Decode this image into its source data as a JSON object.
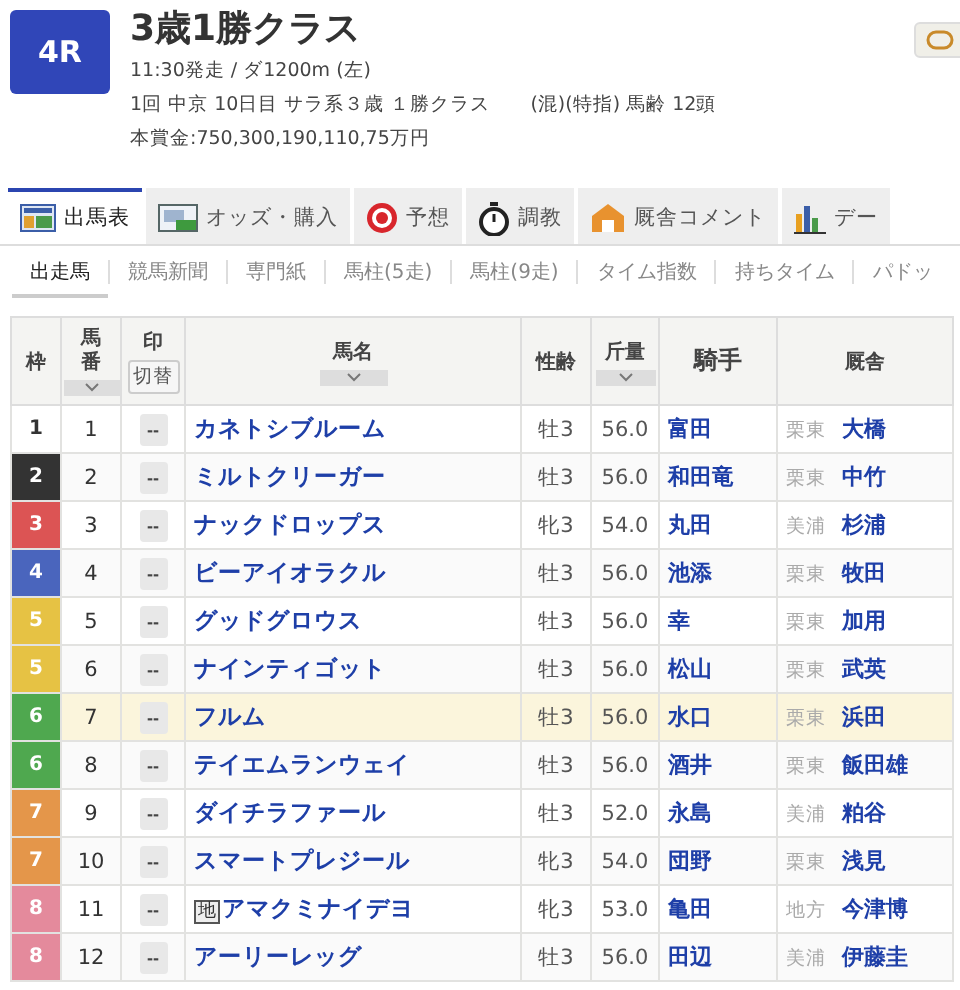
{
  "race": {
    "number": "4R",
    "title": "3歳1勝クラス",
    "time_course": "11:30発走 / ダ1200m (左)",
    "details": "1回 中京 10日目 サラ系３歳 １勝クラス　　(混)(特指) 馬齢 12頭",
    "prize": "本賞金:750,300,190,110,75万円"
  },
  "tabs": [
    {
      "label": "出馬表",
      "selected": true
    },
    {
      "label": "オッズ・購入",
      "selected": false
    },
    {
      "label": "予想",
      "selected": false
    },
    {
      "label": "調教",
      "selected": false
    },
    {
      "label": "厩舎コメント",
      "selected": false
    },
    {
      "label": "デー",
      "selected": false
    }
  ],
  "subtabs": [
    {
      "label": "出走馬",
      "selected": true
    },
    {
      "label": "競馬新聞",
      "selected": false
    },
    {
      "label": "専門紙",
      "selected": false
    },
    {
      "label": "馬柱(5走)",
      "selected": false
    },
    {
      "label": "馬柱(9走)",
      "selected": false
    },
    {
      "label": "タイム指数",
      "selected": false
    },
    {
      "label": "持ちタイム",
      "selected": false
    },
    {
      "label": "パドッ",
      "selected": false
    }
  ],
  "table": {
    "columns": [
      {
        "label": "枠",
        "sortable": false
      },
      {
        "label": "馬番",
        "sortable": true
      },
      {
        "label": "印",
        "sortable": false,
        "toggle": "切替"
      },
      {
        "label": "馬名",
        "sortable": true
      },
      {
        "label": "性齢",
        "sortable": false
      },
      {
        "label": "斤量",
        "sortable": true
      },
      {
        "label": "騎手",
        "sortable": false
      },
      {
        "label": "厩舎",
        "sortable": false
      }
    ],
    "rows": [
      {
        "frame": "1",
        "color": "#ffffff",
        "number": "1",
        "mark": "--",
        "name": "カネトシブルーム",
        "sex_age": "牡3",
        "weight": "56.0",
        "jockey": "富田",
        "stable": "栗東",
        "trainer": "大橋",
        "selected": false
      },
      {
        "frame": "2",
        "color": "#333333",
        "number": "2",
        "mark": "--",
        "name": "ミルトクリーガー",
        "sex_age": "牡3",
        "weight": "56.0",
        "jockey": "和田竜",
        "stable": "栗東",
        "trainer": "中竹",
        "selected": false
      },
      {
        "frame": "3",
        "color": "#dc5454",
        "number": "3",
        "mark": "--",
        "name": "ナックドロップス",
        "sex_age": "牝3",
        "weight": "54.0",
        "jockey": "丸田",
        "stable": "美浦",
        "trainer": "杉浦",
        "selected": false
      },
      {
        "frame": "4",
        "color": "#4a65bd",
        "number": "4",
        "mark": "--",
        "name": "ビーアイオラクル",
        "sex_age": "牡3",
        "weight": "56.0",
        "jockey": "池添",
        "stable": "栗東",
        "trainer": "牧田",
        "selected": false
      },
      {
        "frame": "5",
        "color": "#e6c244",
        "number": "5",
        "mark": "--",
        "name": "グッドグロウス",
        "sex_age": "牡3",
        "weight": "56.0",
        "jockey": "幸",
        "stable": "栗東",
        "trainer": "加用",
        "selected": false
      },
      {
        "frame": "5",
        "color": "#e6c244",
        "number": "6",
        "mark": "--",
        "name": "ナインティゴット",
        "sex_age": "牡3",
        "weight": "56.0",
        "jockey": "松山",
        "stable": "栗東",
        "trainer": "武英",
        "selected": false
      },
      {
        "frame": "6",
        "color": "#4fa84f",
        "number": "7",
        "mark": "--",
        "name": "フルム",
        "sex_age": "牡3",
        "weight": "56.0",
        "jockey": "水口",
        "stable": "栗東",
        "trainer": "浜田",
        "selected": true
      },
      {
        "frame": "6",
        "color": "#4fa84f",
        "number": "8",
        "mark": "--",
        "name": "テイエムランウェイ",
        "sex_age": "牡3",
        "weight": "56.0",
        "jockey": "酒井",
        "stable": "栗東",
        "trainer": "飯田雄",
        "selected": false
      },
      {
        "frame": "7",
        "color": "#e4964a",
        "number": "9",
        "mark": "--",
        "name": "ダイチラファール",
        "sex_age": "牡3",
        "weight": "52.0",
        "jockey": "永島",
        "stable": "美浦",
        "trainer": "粕谷",
        "selected": false
      },
      {
        "frame": "7",
        "color": "#e4964a",
        "number": "10",
        "mark": "--",
        "name": "スマートプレジール",
        "sex_age": "牝3",
        "weight": "54.0",
        "jockey": "団野",
        "stable": "栗東",
        "trainer": "浅見",
        "selected": false
      },
      {
        "frame": "8",
        "color": "#e48a9c",
        "number": "11",
        "mark": "--",
        "badge": "地",
        "name": "アマクミナイデヨ",
        "sex_age": "牝3",
        "weight": "53.0",
        "jockey": "亀田",
        "stable": "地方",
        "trainer": "今津博",
        "selected": false
      },
      {
        "frame": "8",
        "color": "#e48a9c",
        "number": "12",
        "mark": "--",
        "name": "アーリーレッグ",
        "sex_age": "牡3",
        "weight": "56.0",
        "jockey": "田辺",
        "stable": "美浦",
        "trainer": "伊藤圭",
        "selected": false
      }
    ]
  }
}
